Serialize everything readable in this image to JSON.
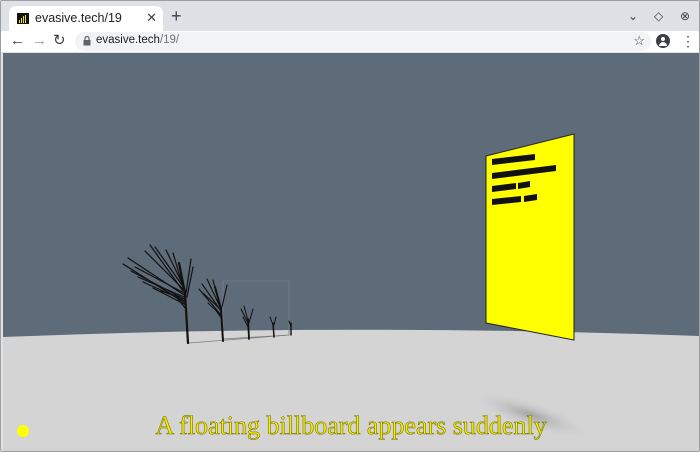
{
  "browser": {
    "tab_title": "evasive.tech/19",
    "tab_close_icon": "close-icon",
    "new_tab_icon": "plus-icon",
    "url_host": "evasive.tech",
    "url_path": "/19/",
    "icons": {
      "back": "arrow-left-icon",
      "forward": "arrow-right-icon",
      "reload": "reload-icon",
      "lock": "lock-icon",
      "star": "star-icon",
      "profile": "account-icon",
      "menu": "more-vert-icon",
      "minimize": "chevron-down-icon",
      "restore": "diamond-icon",
      "close_window": "close-circle-icon"
    }
  },
  "scene": {
    "caption": "A floating billboard appears suddenly",
    "colors": {
      "sky": "#5e6b78",
      "ground": "#d4d4d4",
      "billboard": "#ffff00",
      "caption": "#f5ef00",
      "indicator": "#ffff00"
    }
  }
}
